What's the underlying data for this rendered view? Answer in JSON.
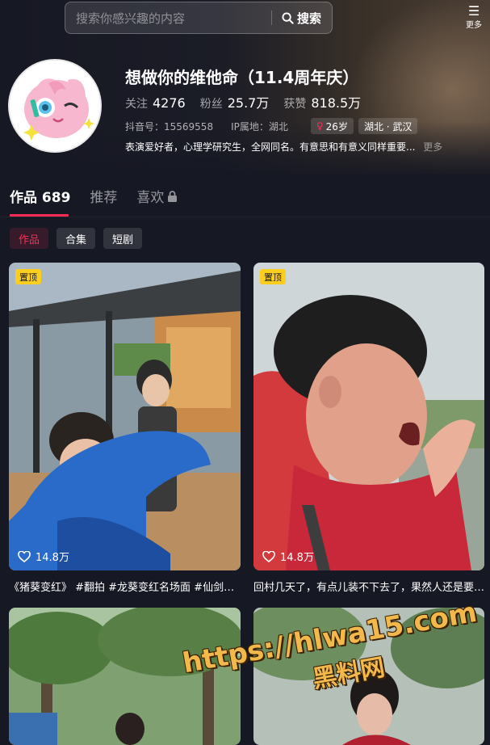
{
  "search": {
    "placeholder": "搜索你感兴趣的内容",
    "button_label": "搜索"
  },
  "top_menu": {
    "more_label": "更多"
  },
  "profile": {
    "name": "想做你的维他命（11.4周年庆）",
    "stats": [
      {
        "label": "关注",
        "value": "4276"
      },
      {
        "label": "粉丝",
        "value": "25.7万"
      },
      {
        "label": "获赞",
        "value": "818.5万"
      }
    ],
    "douyin_id": "抖音号：15569558",
    "ip_location": "IP属地：湖北",
    "age_tag": "26岁",
    "region_tag": "湖北 · 武汉",
    "bio": "表演爱好者，心理学研究生，全网同名。有意思和有意义同样重要...",
    "bio_more": "更多"
  },
  "tabs": [
    {
      "label": "作品 689",
      "active": true
    },
    {
      "label": "推荐",
      "active": false
    },
    {
      "label": "喜欢",
      "active": false
    }
  ],
  "subtabs": [
    {
      "label": "作品",
      "active": true
    },
    {
      "label": "合集",
      "active": false
    },
    {
      "label": "短剧",
      "active": false
    }
  ],
  "videos": [
    {
      "pinned_label": "置顶",
      "likes": "14.8万",
      "caption": "《猪葵变红》 #翻拍 #龙葵变红名场面 #仙剑奇侠传"
    },
    {
      "pinned_label": "置顶",
      "likes": "14.8万",
      "caption": "回村几天了，有点儿装不下去了，果然人还是要回归本性"
    },
    {
      "pinned_label": "",
      "likes": "",
      "caption": ""
    },
    {
      "pinned_label": "",
      "likes": "",
      "caption": ""
    }
  ],
  "watermark": {
    "url": "https://hlwa15.com",
    "name": "黑料网"
  },
  "colors": {
    "accent": "#fe2c55",
    "background": "#161823",
    "pin": "#facd1f"
  }
}
